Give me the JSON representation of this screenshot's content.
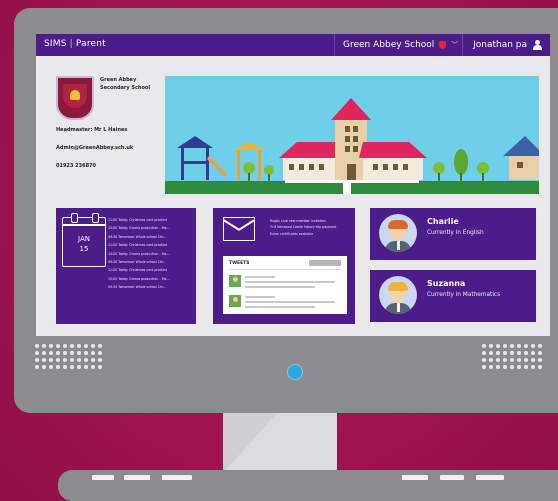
{
  "colors": {
    "background": "#a0144f",
    "frame": "#8c8c8e",
    "accent_purple": "#4b1c8a",
    "power_light": "#2da6dd"
  },
  "topbar": {
    "app_name": "SIMS",
    "divider": "|",
    "section": "Parent",
    "school_name": "Green Abbey School",
    "user_name": "Jonathan pa",
    "icons": [
      "school-crest-icon",
      "chevron-down-icon",
      "user-icon"
    ]
  },
  "school": {
    "name_line1": "Green Abbey",
    "name_line2": "Secondary School",
    "headmaster": "Headmaster: Mr L Haines",
    "email": "Admin@GreenAbbey.sch.uk",
    "phone": "01923 236870"
  },
  "calendar": {
    "month": "JAN",
    "day": "15",
    "events": [
      "11:00 Today: Christmas card practice",
      "15:00 Today: Drama production – Ma...",
      "09:30 Tomorrow: Whole school Chr...",
      "11:00 Today: Christmas card practice",
      "15:00 Today: Drama production – Ma...",
      "09:30 Tomorrow: Whole school Chr...",
      "11:00 Today: Christmas card practice",
      "15:00 Today: Drama production – Ma...",
      "09:30 Tomorrow: Whole school Chr..."
    ]
  },
  "messages": {
    "items": [
      "Rugby club new member invitation",
      "Yr 8 Kenwood Castle history trip payment",
      "Exam certificates available"
    ],
    "tweets_title": "TWEETS"
  },
  "students": [
    {
      "name": "Charlie",
      "status": "Currently in English",
      "hair_color": "#d86a2a"
    },
    {
      "name": "Suzanna",
      "status": "Currently in Mathematics",
      "hair_color": "#f2b233"
    }
  ]
}
